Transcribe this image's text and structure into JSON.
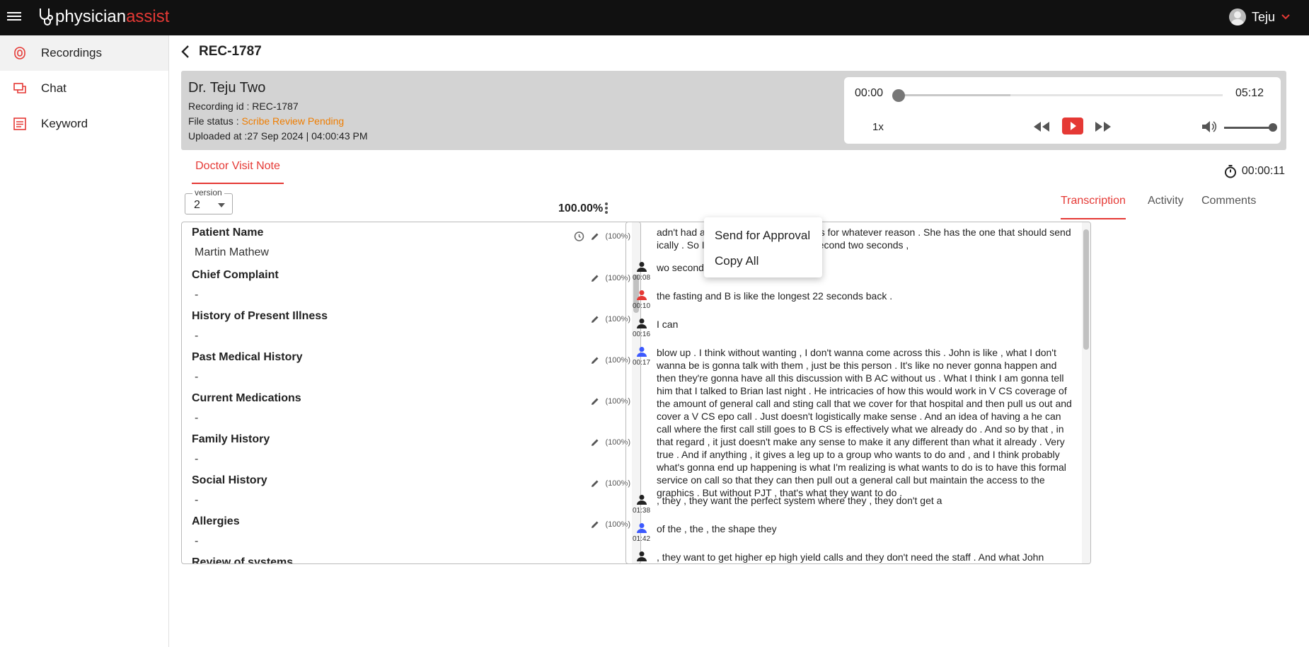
{
  "app": {
    "brand_part1": "physician",
    "brand_part2": "assist"
  },
  "user": {
    "name": "Teju"
  },
  "sidebar": {
    "items": [
      {
        "label": "Recordings",
        "icon": "recordings-icon",
        "active": true
      },
      {
        "label": "Chat",
        "icon": "chat-icon",
        "active": false
      },
      {
        "label": "Keyword",
        "icon": "keyword-icon",
        "active": false
      }
    ]
  },
  "header": {
    "title": "REC-1787"
  },
  "info": {
    "doctor": "Dr. Teju Two",
    "recording_id": "Recording id : REC-1787",
    "status_label": "File status : ",
    "status_value": "Scribe Review Pending",
    "uploaded": "Uploaded at :27 Sep 2024 | 04:00:43 PM"
  },
  "player": {
    "current": "00:00",
    "duration": "05:12",
    "speed": "1x",
    "progress": 0.0,
    "volume": 1.0
  },
  "note_tab": "Doctor Visit Note",
  "timer": "00:00:11",
  "version": {
    "label": "version",
    "value": "2"
  },
  "overall_percent": "100.00%",
  "right_tabs": [
    "Transcription",
    "Activity",
    "Comments"
  ],
  "sections": [
    {
      "title": "Patient Name",
      "value": "Martin Mathew",
      "percent": "(100%)"
    },
    {
      "title": "Chief Complaint",
      "value": "-",
      "percent": "(100%)"
    },
    {
      "title": "History of Present Illness",
      "value": "-",
      "percent": "(100%)"
    },
    {
      "title": "Past Medical History",
      "value": "-",
      "percent": "(100%)"
    },
    {
      "title": "Current Medications",
      "value": "-",
      "percent": "(100%)"
    },
    {
      "title": "Family History",
      "value": "-",
      "percent": "(100%)"
    },
    {
      "title": "Social History",
      "value": "-",
      "percent": "(100%)"
    },
    {
      "title": "Allergies",
      "value": "-",
      "percent": "(100%)"
    },
    {
      "title": "Review of systems",
      "value": "",
      "percent": ""
    }
  ],
  "menu": {
    "items": [
      "Send for Approval",
      "Copy All"
    ]
  },
  "transcript": [
    {
      "time": "",
      "color": "#222222",
      "text": "adn't had any car link sent to you guys for whatever reason . She has the one that should send ically . So I don't know if there's the second two seconds ,"
    },
    {
      "time": "00:08",
      "color": "#222222",
      "text": "wo seconds"
    },
    {
      "time": "00:10",
      "color": "#e53935",
      "text": "the fasting and B is like the longest 22 seconds back ."
    },
    {
      "time": "00:16",
      "color": "#222222",
      "text": "I can"
    },
    {
      "time": "00:17",
      "color": "#3d5afe",
      "text": "blow up . I think without wanting , I don't wanna come across this . John is like , what I don't wanna be is gonna talk with them , just be this person . It's like no never gonna happen and then they're gonna have all this discussion with B AC without us . What I think I am gonna tell him that I talked to Brian last night . He intricacies of how this would work in V CS coverage of the amount of general call and sting call that we cover for that hospital and then pull us out and cover a V CS epo call . Just doesn't logistically make sense . And an idea of having a he can call where the first call still goes to B CS is effectively what we already do . And so by that , in that regard , it just doesn't make any sense to make it any different than what it already . Very true . And if anything , it gives a leg up to a group who wants to do and , and I think probably what's gonna end up happening is what I'm realizing is what wants to do is to have this formal service on call so that they can then pull out a general call but maintain the access to the graphics . But without PJT , that's what they want to do ."
    },
    {
      "time": "01:38",
      "color": "#222222",
      "text": ", they , they want the perfect system where they , they don't get a"
    },
    {
      "time": "01:42",
      "color": "#3d5afe",
      "text": "of the , the , the shape they"
    },
    {
      "time": "",
      "color": "#222222",
      "text": ", they want to get higher ep high yield calls and they don't need the staff . And what John Gardner , John"
    }
  ]
}
